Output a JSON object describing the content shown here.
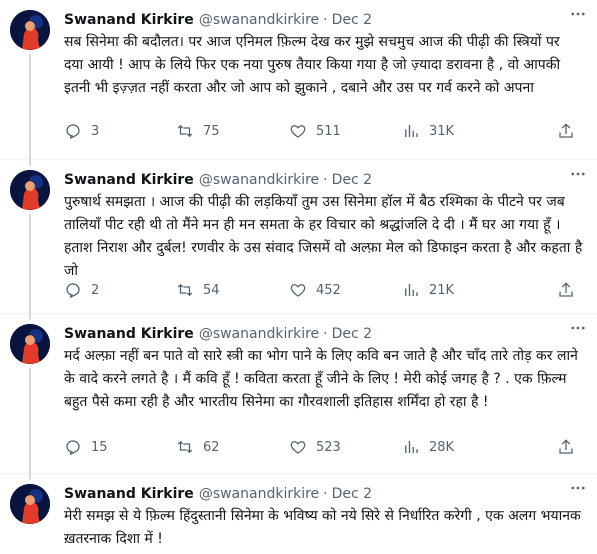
{
  "tweets": [
    {
      "name": "Swanand Kirkire",
      "handle": "@swanandkirkire",
      "separator": "·",
      "date": "Dec 2",
      "text": "सब सिनेमा की बदौलत।  पर आज एनिमल फ़िल्म देख कर मुझे सचमुच आज की पीढ़ी की स्त्रियों पर दया आयी ! आप के लिये फिर एक नया पुरुष तैयार किया गया है जो ज़्यादा डरावना है , वो आपकी इतनी भी इज़्ज़त नहीं करता और जो आप को झुकाने , दबाने और उस पर  गर्व करने को अपना",
      "replies": "3",
      "retweets": "75",
      "likes": "511",
      "views": "31K"
    },
    {
      "name": "Swanand Kirkire",
      "handle": "@swanandkirkire",
      "separator": "·",
      "date": "Dec 2",
      "text": "पुरुषार्थ समझता । आज की पीढ़ी की लड़कियाँ तुम उस सिनेमा हॉल में बैठ रश्मिका के पीटने पर जब तालियाँ पीट रही थी तो मैंने मन ही मन समता के हर विचार को श्रद्धांजलि दे दी । मैं घर आ गया हूँ । हताश निराश और दुर्बल! रणवीर के उस संवाद जिसमें वो अल्फ़ा मेल को डिफाइन करता है और कहता है जो",
      "replies": "2",
      "retweets": "54",
      "likes": "452",
      "views": "21K"
    },
    {
      "name": "Swanand Kirkire",
      "handle": "@swanandkirkire",
      "separator": "·",
      "date": "Dec 2",
      "text": "मर्द अल्फ़ा नहीं बन पाते वो सारे स्त्री का भोग पाने के लिए कवि बन जाते है और चाँद तारे तोड़ कर लाने के वादे करने लगते है । मैं कवि हूँ ! कविता करता हूँ जीने के लिए ! मेरी कोई जगह है ? . एक फ़िल्म बहुत पैसे कमा रही है और भारतीय सिनेमा का गौरवशाली इतिहास शर्मिंदा हो रहा है !",
      "replies": "15",
      "retweets": "62",
      "likes": "523",
      "views": "28K"
    },
    {
      "name": "Swanand Kirkire",
      "handle": "@swanandkirkire",
      "separator": "·",
      "date": "Dec 2",
      "text": "मेरी समझ से ये फ़िल्म  हिंदुस्तानी सिनेमा के भविष्य को नये सिरे से निर्धारित करेगी , एक अलग भयानक ख़तरनाक दिशा में !"
    }
  ],
  "icons": {
    "more": "more-icon",
    "reply": "reply-icon",
    "retweet": "retweet-icon",
    "like": "like-icon",
    "views": "views-icon",
    "share": "share-icon"
  },
  "colors": {
    "text": "#0f1419",
    "secondary": "#536471",
    "divider": "#eff3f4",
    "thread_line": "#cfd9de",
    "avatar_bg": "#0a1440"
  }
}
